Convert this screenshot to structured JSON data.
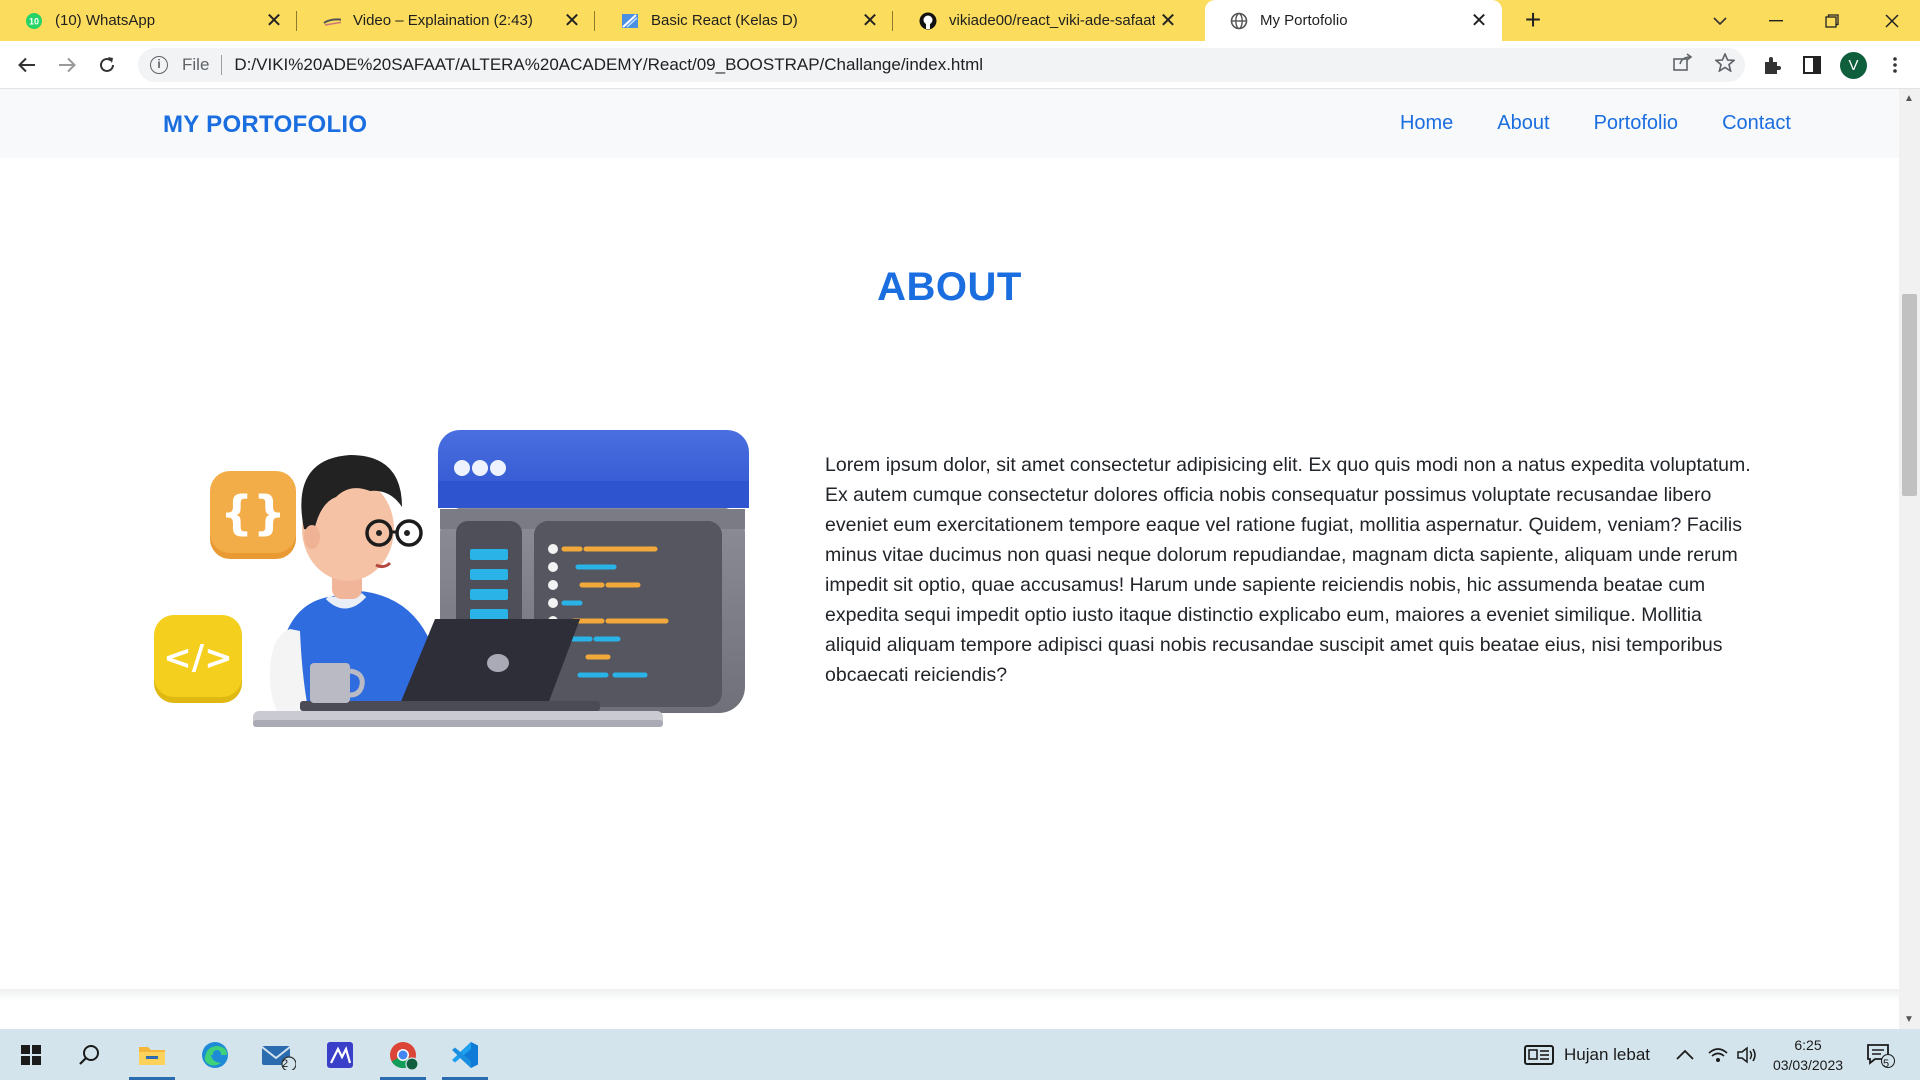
{
  "browser": {
    "tabs": [
      {
        "title": "(10) WhatsApp",
        "icon": "whatsapp-icon",
        "badge": "10",
        "active": false
      },
      {
        "title": "Video – Explaination (2:43)",
        "icon": "video-icon",
        "active": false
      },
      {
        "title": "Basic React (Kelas D)",
        "icon": "classroom-icon",
        "active": false
      },
      {
        "title": "vikiade00/react_viki-ade-safaat",
        "icon": "github-icon",
        "active": false
      },
      {
        "title": "My Portofolio",
        "icon": "globe-icon",
        "active": true
      }
    ],
    "address": {
      "scheme": "File",
      "url": "D:/VIKI%20ADE%20SAFAAT/ALTERA%20ACADEMY/React/09_BOOSTRAP/Challange/index.html"
    },
    "profile_initial": "V",
    "accent": "#fbdc5c"
  },
  "page": {
    "brand": "MY PORTOFOLIO",
    "nav": [
      "Home",
      "About",
      "Portofolio",
      "Contact"
    ],
    "section_title": "ABOUT",
    "about_text": "Lorem ipsum dolor, sit amet consectetur adipisicing elit. Ex quo quis modi non a natus expedita voluptatum. Ex autem cumque consectetur dolores officia nobis consequatur possimus voluptate recusandae libero eveniet eum exercitationem tempore eaque vel ratione fugiat, mollitia aspernatur. Quidem, veniam? Facilis minus vitae ducimus non quasi neque dolorum repudiandae, magnam dicta sapiente, aliquam unde rerum impedit sit optio, quae accusamus! Harum unde sapiente reiciendis nobis, hic assumenda beatae cum expedita sequi impedit optio iusto itaque distinctio explicabo eum, maiores a eveniet similique. Mollitia aliquid aliquam tempore adipisci quasi nobis recusandae suscipit amet quis beatae eius, nisi temporibus obcaecati reiciendis?",
    "accent": "#1a6ee0"
  },
  "taskbar": {
    "mail_badge": "2",
    "weather": "Hujan lebat",
    "time": "6:25",
    "date": "03/03/2023",
    "notifications": "5"
  }
}
